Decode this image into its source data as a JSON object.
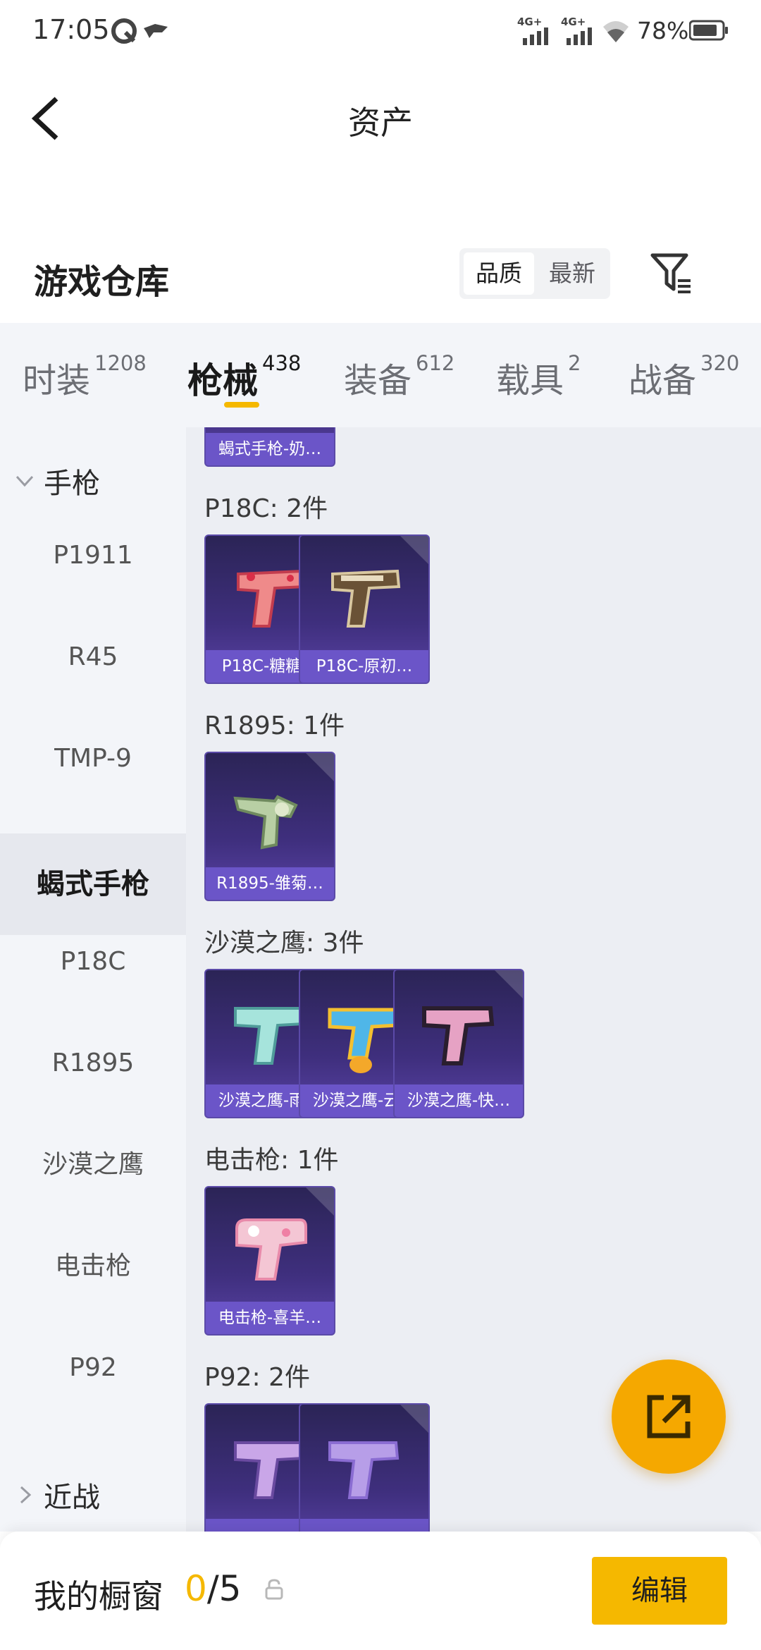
{
  "status_bar": {
    "time": "17:05",
    "network1": "4G+",
    "network2": "4G+",
    "battery": "78%"
  },
  "header": {
    "title": "资产"
  },
  "section": {
    "title": "游戏仓库",
    "sort_options": [
      "品质",
      "最新"
    ],
    "sort_active": "品质"
  },
  "tabs": [
    {
      "label": "时装",
      "count": "1208"
    },
    {
      "label": "枪械",
      "count": "438",
      "active": true
    },
    {
      "label": "装备",
      "count": "612"
    },
    {
      "label": "载具",
      "count": "2"
    },
    {
      "label": "战备",
      "count": "320"
    }
  ],
  "sidebar": {
    "group_open": "手枪",
    "items": [
      "P1911",
      "R45",
      "TMP-9",
      "蝎式手枪",
      "P18C",
      "R1895",
      "沙漠之鹰",
      "电击枪",
      "P92"
    ],
    "active_item": "蝎式手枪",
    "group_closed": "近战"
  },
  "content": {
    "top_card": "蝎式手枪-奶…",
    "groups": [
      {
        "title": "P18C: 2件",
        "cards": [
          "P18C-糖糖…",
          "P18C-原初…"
        ]
      },
      {
        "title": "R1895: 1件",
        "cards": [
          "R1895-雏菊…"
        ]
      },
      {
        "title": "沙漠之鹰: 3件",
        "cards": [
          "沙漠之鹰-雨…",
          "沙漠之鹰-云…",
          "沙漠之鹰-快…"
        ]
      },
      {
        "title": "电击枪: 1件",
        "cards": [
          "电击枪-喜羊…"
        ]
      },
      {
        "title": "P92: 2件",
        "cards": [
          "",
          ""
        ]
      }
    ]
  },
  "bottom_bar": {
    "label": "我的橱窗",
    "current": "0",
    "total": "/5",
    "edit": "编辑"
  },
  "colors": {
    "accent": "#f5b800",
    "card_bg": "#3f2f7e",
    "card_caption": "#6b55c8"
  },
  "icons": [
    "back-icon",
    "filter-icon",
    "share-icon",
    "lock-icon",
    "chevron-down-icon",
    "chevron-right-icon"
  ]
}
